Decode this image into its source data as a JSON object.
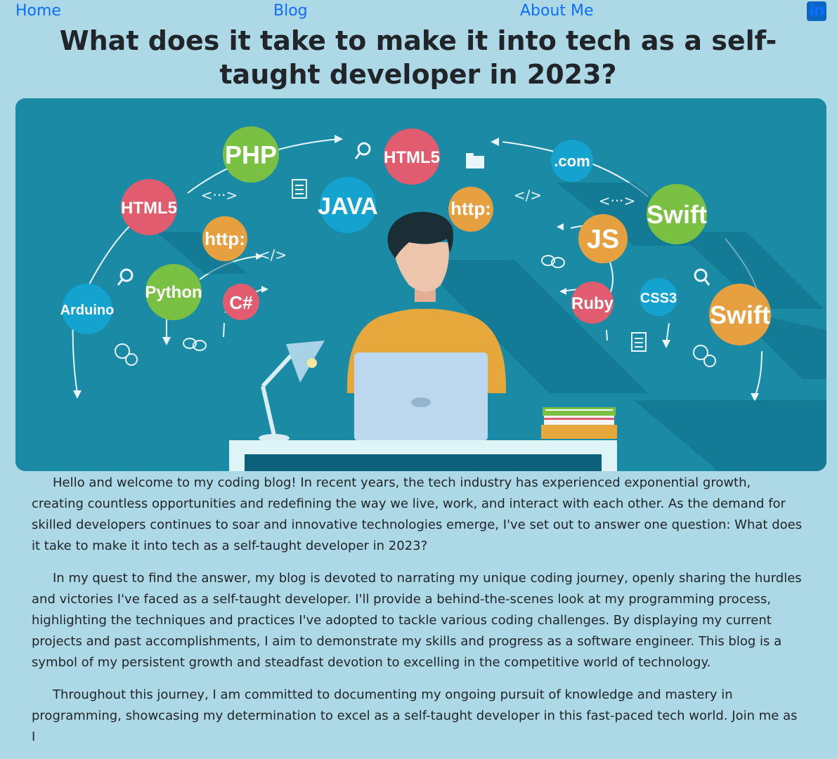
{
  "nav": {
    "home": "Home",
    "blog": "Blog",
    "about": "About Me",
    "linkedin_glyph": "in"
  },
  "header": {
    "title": "What does it take to make it into tech as a self-taught developer in 2023?"
  },
  "hero": {
    "bubbles": {
      "php": "PHP",
      "html5_left": "HTML5",
      "http_left": "http:",
      "python": "Python",
      "arduino": "Arduino",
      "csharp": "C#",
      "html5_center": "HTML5",
      "java": "JAVA",
      "http_center": "http:",
      "dotcom": ".com",
      "swift_top": "Swift",
      "js": "JS",
      "ruby": "Ruby",
      "css3": "CSS3",
      "swift_bottom": "Swift"
    },
    "glyphs": {
      "tag_dots": "<···>",
      "tag_close": "</>"
    }
  },
  "article": {
    "paragraphs": [
      "Hello and welcome to my coding blog! In recent years, the tech industry has experienced exponential growth, creating countless opportunities and redefining the way we live, work, and interact with each other. As the demand for skilled developers continues to soar and innovative technologies emerge, I've set out to answer one question: What does it take to make it into tech as a self-taught developer in 2023?",
      "In my quest to find the answer, my blog is devoted to narrating my unique coding journey, openly sharing the hurdles and victories I've faced as a self-taught developer. I'll provide a behind-the-scenes look at my programming process, highlighting the techniques and practices I've adopted to tackle various coding challenges. By displaying my current projects and past accomplishments, I aim to demonstrate my skills and progress as a software engineer. This blog is a symbol of my persistent growth and steadfast devotion to excelling in the competitive world of technology.",
      "Throughout this journey, I am committed to documenting my ongoing pursuit of knowledge and mastery in programming, showcasing my determination to excel as a self-taught developer in this fast-paced tech world. Join me as I"
    ]
  },
  "colors": {
    "page_bg": "#add8e6",
    "link": "#0d6efd",
    "hero_bg": "#1a8aa5",
    "linkedin": "#0a66c2"
  }
}
